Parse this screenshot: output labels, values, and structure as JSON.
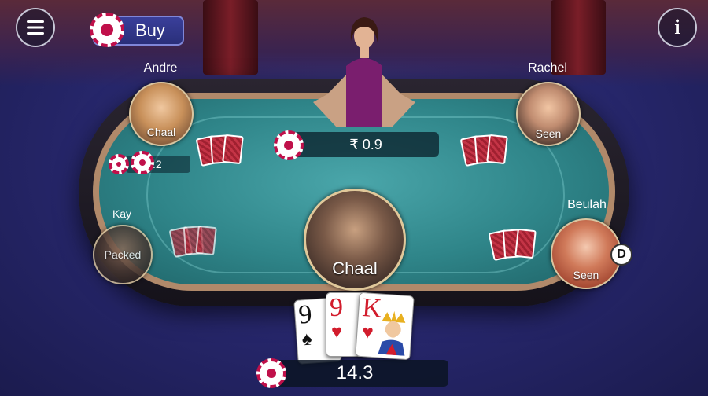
{
  "header": {
    "buy_label": "Buy",
    "menu_icon": "hamburger-icon",
    "info_icon": "info-icon",
    "info_glyph": "i"
  },
  "pot": {
    "amount": "₹ 0.9"
  },
  "players": {
    "andre": {
      "name": "Andre",
      "status": "Chaal",
      "bet": ".2"
    },
    "rachel": {
      "name": "Rachel",
      "status": "Seen"
    },
    "kay": {
      "name": "Kay",
      "status": "Packed"
    },
    "beulah": {
      "name": "Beulah",
      "status": "Seen",
      "badge": "D"
    },
    "me": {
      "status": "Chaal"
    }
  },
  "hand": [
    {
      "rank": "9",
      "suit": "♠",
      "color": "black"
    },
    {
      "rank": "9",
      "suit": "♥",
      "color": "red"
    },
    {
      "rank": "K",
      "suit": "♥",
      "color": "red"
    }
  ],
  "balance": {
    "amount": "14.3"
  },
  "colors": {
    "chip": "#c0104a",
    "felt": "#2f8589",
    "rim": "#b0896a"
  }
}
